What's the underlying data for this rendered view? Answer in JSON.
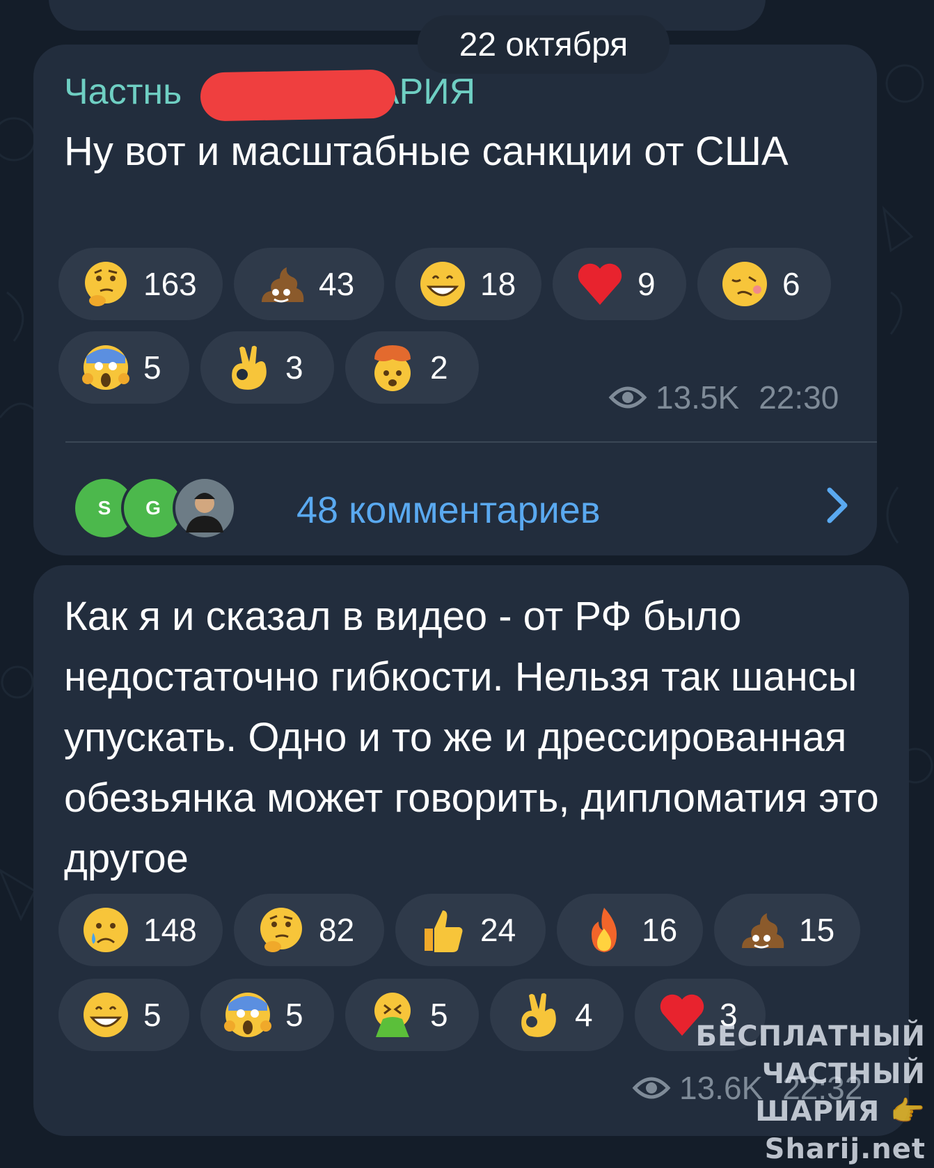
{
  "date_separator": "22 октября",
  "post1": {
    "channel_name": "Частнь████ШАРИЯ",
    "channel_name_visible_left": "Частнь",
    "channel_name_visible_right": "ШАРИЯ",
    "text": "Ну вот и масштабные санкции от США",
    "reactions": [
      {
        "emoji": "thinking-face",
        "count": "163"
      },
      {
        "emoji": "pile-of-poo",
        "count": "43"
      },
      {
        "emoji": "grinning-face",
        "count": "18"
      },
      {
        "emoji": "red-heart",
        "count": "9"
      },
      {
        "emoji": "woozy-face",
        "count": "6"
      },
      {
        "emoji": "screaming-face",
        "count": "5"
      },
      {
        "emoji": "ok-hand",
        "count": "3"
      },
      {
        "emoji": "exploding-head",
        "count": "2"
      }
    ],
    "views": "13.5K",
    "time": "22:30",
    "comments_label": "48 комментариев",
    "comment_avatars": [
      "S",
      "G"
    ]
  },
  "post2": {
    "text": "Как я и сказал в видео - от РФ было недостаточно гибкости. Нельзя так шансы упускать. Одно и то же и дрессированная обезьянка может говорить, дипломатия это другое",
    "reactions": [
      {
        "emoji": "crying-face",
        "count": "148"
      },
      {
        "emoji": "thinking-face",
        "count": "82"
      },
      {
        "emoji": "thumbs-up",
        "count": "24"
      },
      {
        "emoji": "fire",
        "count": "16"
      },
      {
        "emoji": "pile-of-poo",
        "count": "15"
      },
      {
        "emoji": "grinning-face",
        "count": "5"
      },
      {
        "emoji": "screaming-face",
        "count": "5"
      },
      {
        "emoji": "vomiting-face",
        "count": "5"
      },
      {
        "emoji": "ok-hand",
        "count": "4"
      },
      {
        "emoji": "red-heart",
        "count": "3"
      }
    ],
    "views": "13.6K",
    "time": "22:32"
  },
  "watermark": {
    "line1": "БЕСПЛАТНЫЙ ЧАСТНЫЙ",
    "line2": "ШАРИЯ 👉 Sharij.net"
  },
  "colors": {
    "background": "#141d29",
    "bubble": "#222d3d",
    "pill": "#2f3a4a",
    "channel_name": "#6fcfc3",
    "link": "#5aa9f0",
    "meta": "#7f8b98",
    "redaction": "#ef3f3f"
  }
}
